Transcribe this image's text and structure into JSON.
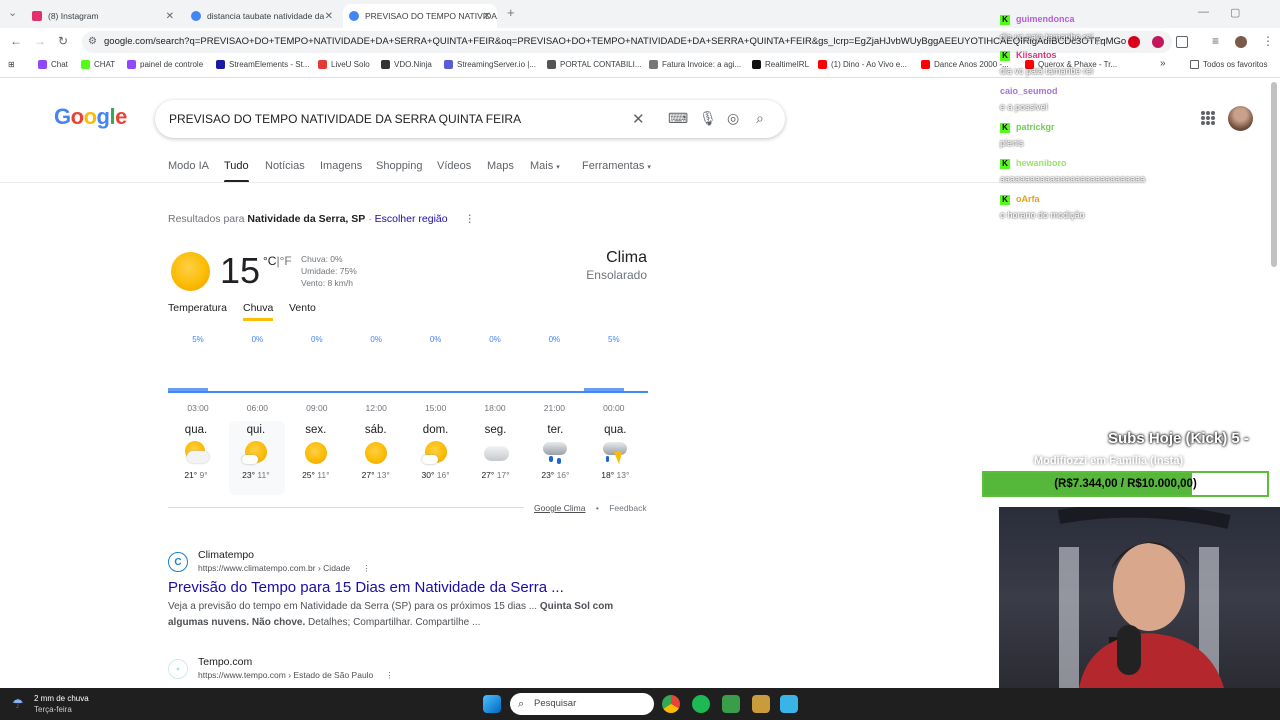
{
  "browser": {
    "tabs": [
      {
        "title": "(8) Instagram",
        "color": "#e1306c"
      },
      {
        "title": "distancia taubate natividade da",
        "color": "#4285f4"
      },
      {
        "title": "PREVISAO DO TEMPO NATIVIDA",
        "color": "#4285f4",
        "active": true
      }
    ],
    "new_tab": "+",
    "url": "google.com/search?q=PREVISAO+DO+TEMPO+NATIVIDADE+DA+SERRA+QUINTA+FEIR&oq=PREVISAO+DO+TEMPO+NATIVIDADE+DA+SERRA+QUINTA+FEIR&gs_lcrp=EgZjaHJvbWUyBggAEEUYOTIHCAEQIRigAdIBCDc3OTFqMGo",
    "bookmarks": [
      {
        "label": "Chat",
        "color": "#9146ff"
      },
      {
        "label": "CHAT",
        "color": "#53fc18"
      },
      {
        "label": "painel de controle",
        "color": "#9146ff"
      },
      {
        "label": "StreamElements - St...",
        "color": "#1a1aa6"
      },
      {
        "label": "LiveU Solo",
        "color": "#e53935"
      },
      {
        "label": "VDO.Ninja",
        "color": "#333333"
      },
      {
        "label": "StreamingServer.io |...",
        "color": "#5b5bd6"
      },
      {
        "label": "PORTAL CONTABILI...",
        "color": "#555555"
      },
      {
        "label": "Fatura Invoice: a agi...",
        "color": "#777777"
      },
      {
        "label": "RealtimeIRL",
        "color": "#111111"
      },
      {
        "label": "(1) Dino - Ao Vivo e...",
        "color": "#ff0000"
      },
      {
        "label": "Dance Anos 2000 -...",
        "color": "#ff0000"
      },
      {
        "label": "Querox & Phaxe - Tr...",
        "color": "#ff0000"
      }
    ],
    "bookmarks_more": "»",
    "all_bookmarks": "Todos os favoritos"
  },
  "google": {
    "logo": "Google",
    "query": "PREVISAO DO TEMPO NATIVIDADE DA SERRA QUINTA FEIRA",
    "nav_tabs": [
      "Modo IA",
      "Tudo",
      "Notícias",
      "Imagens",
      "Shopping",
      "Vídeos",
      "Maps",
      "Mais",
      "Ferramentas"
    ],
    "results_for_prefix": "Resultados para",
    "results_for_place": "Natividade da Serra, SP",
    "results_for_sep": "·",
    "choose_region": "Escolher região",
    "more_dots": "⋮"
  },
  "weather": {
    "temp": "15",
    "unit_c": "°C",
    "unit_sep": "|",
    "unit_f": "°F",
    "rain": "Chuva: 0%",
    "humidity": "Umidade: 75%",
    "wind": "Vento: 8 km/h",
    "title": "Clima",
    "condition": "Ensolarado",
    "tabs": [
      "Temperatura",
      "Chuva",
      "Vento"
    ],
    "active_tab": "Chuva",
    "chart_data": {
      "type": "bar",
      "categories": [
        "03:00",
        "06:00",
        "09:00",
        "12:00",
        "15:00",
        "18:00",
        "21:00",
        "00:00"
      ],
      "values": [
        5,
        0,
        0,
        0,
        0,
        0,
        0,
        5
      ],
      "value_labels": [
        "5%",
        "0%",
        "0%",
        "0%",
        "0%",
        "0%",
        "0%",
        "5%"
      ],
      "title": "",
      "xlabel": "",
      "ylabel": ""
    },
    "days": [
      {
        "name": "qua.",
        "icon": "partly-cloudy-icon",
        "hi": "21°",
        "lo": "9°"
      },
      {
        "name": "qui.",
        "icon": "partly-sunny-icon",
        "hi": "23°",
        "lo": "11°",
        "selected": true
      },
      {
        "name": "sex.",
        "icon": "sunny-icon",
        "hi": "25°",
        "lo": "11°"
      },
      {
        "name": "sáb.",
        "icon": "sunny-icon",
        "hi": "27°",
        "lo": "13°"
      },
      {
        "name": "dom.",
        "icon": "partly-sunny-icon",
        "hi": "30°",
        "lo": "16°"
      },
      {
        "name": "seg.",
        "icon": "cloudy-icon",
        "hi": "27°",
        "lo": "17°"
      },
      {
        "name": "ter.",
        "icon": "rain-icon",
        "hi": "23°",
        "lo": "16°"
      },
      {
        "name": "qua.",
        "icon": "thunderstorm-icon",
        "hi": "18°",
        "lo": "13°"
      }
    ],
    "footer_link": "Google Clima",
    "footer_sep": "•",
    "feedback": "Feedback"
  },
  "results": [
    {
      "site": "Climatempo",
      "url": "https://www.climatempo.com.br › Cidade",
      "title": "Previsão do Tempo para 15 Dias em Natividade da Serra ...",
      "snippet_a": "Veja a previsão do tempo em Natividade da Serra (SP) para os próximos 15 dias ...",
      "snippet_b1": "Quinta Sol com",
      "snippet_b2": "algumas nuvens. Não chove.",
      "snippet_c": "Detalhes; Compartilhar. Compartilhe ...",
      "icon_color": "#1b7fd1"
    },
    {
      "site": "Tempo.com",
      "url": "https://www.tempo.com › Estado de São Paulo",
      "icon_color": "#29b6c9"
    }
  ],
  "overlay": {
    "chat": [
      {
        "user": "guimendonca",
        "color": "#b55fd6",
        "msg": ""
      },
      {
        "user": "Kiisantos",
        "color": "#e0357a",
        "msg": "dia vc paia tamanbe rei"
      },
      {
        "user": "caio_seumod",
        "color": "#a872d8",
        "msg": "e a possivel"
      },
      {
        "user": "patrickgr",
        "color": "#6dce4b",
        "msg": "plenis"
      },
      {
        "user": "hewaniboro",
        "color": "#9be26b",
        "msg": "aaaaaaaaaaaaaaaaaaaaaaaaaaaaa"
      },
      {
        "user": "oArfa",
        "color": "#e6a21a",
        "msg": "o horario do modição"
      }
    ],
    "subs_label": "Subs Hoje (Kick)  5 -",
    "goal_sub": "Modifiozzi em Família (Insta)",
    "goal_text": "(R$7.344,00 / R$10.000,00)",
    "goal_progress": 0.7344
  },
  "taskbar": {
    "weather_line1": "2 mm de chuva",
    "weather_line2": "Terça-feira",
    "search": "Pesquisar"
  }
}
